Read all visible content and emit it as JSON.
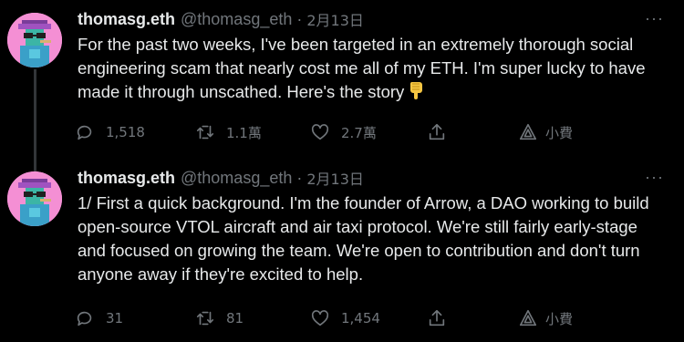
{
  "tweets": [
    {
      "name": "thomasg.eth",
      "handle": "@thomasg_eth",
      "separator": "·",
      "date": "2月13日",
      "text": "For the past two weeks, I've been targeted in an extremely thorough social engineering scam that nearly cost me all of my ETH. I'm super lucky to have made it through unscathed. Here's the story",
      "emoji": "point-down-emoji",
      "more_label": "···",
      "replies": "1,518",
      "retweets": "1.1萬",
      "likes": "2.7萬",
      "tip_label": "小費"
    },
    {
      "name": "thomasg.eth",
      "handle": "@thomasg_eth",
      "separator": "·",
      "date": "2月13日",
      "text": "1/ First a quick background. I'm the founder of Arrow, a DAO working to build open-source VTOL aircraft and air taxi protocol. We're still fairly early-stage and focused on growing the team. We're open to contribution and don't turn anyone away if they're excited to help.",
      "more_label": "···",
      "replies": "31",
      "retweets": "81",
      "likes": "1,454",
      "tip_label": "小費"
    }
  ],
  "colors": {
    "background": "#000000",
    "text": "#e7e9ea",
    "secondary": "#71767b",
    "thread_line": "#333639",
    "avatar_bg": "#f090d0"
  },
  "icons": [
    "reply-icon",
    "retweet-icon",
    "like-icon",
    "share-icon",
    "tip-icon",
    "more-icon"
  ]
}
